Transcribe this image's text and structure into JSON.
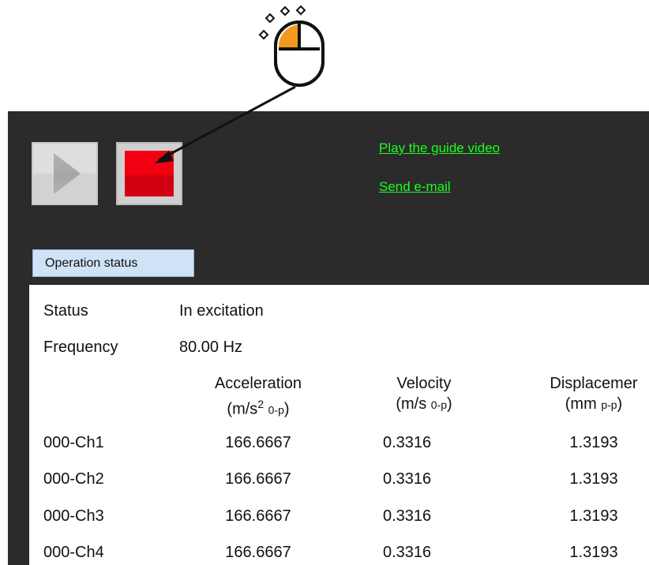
{
  "toolbar": {
    "play_icon": "play-icon",
    "stop_icon": "stop-icon",
    "stop_color": "#f00010"
  },
  "links": {
    "guide_video": "Play the guide video",
    "send_email": "Send e-mail",
    "color": "#19ff1e"
  },
  "tab": {
    "label": "Operation status"
  },
  "status": {
    "status_label": "Status",
    "status_value": "In excitation",
    "frequency_label": "Frequency",
    "frequency_value": "80.00 Hz"
  },
  "table": {
    "columns": [
      {
        "name": "Acceleration",
        "unit_open": "(m/s",
        "unit_sup": "2",
        "unit_sub": "0-p",
        "unit_close": ")"
      },
      {
        "name": "Velocity",
        "unit_open": "(m/s",
        "unit_sup": "",
        "unit_sub": "0-p",
        "unit_close": ")"
      },
      {
        "name": "Displacemer",
        "unit_open": "(mm",
        "unit_sup": "",
        "unit_sub": "p-p",
        "unit_close": ")"
      }
    ],
    "rows": [
      {
        "channel": "000-Ch1",
        "acceleration": "166.6667",
        "velocity": "0.3316",
        "displacement": "1.3193"
      },
      {
        "channel": "000-Ch2",
        "acceleration": "166.6667",
        "velocity": "0.3316",
        "displacement": "1.3193"
      },
      {
        "channel": "000-Ch3",
        "acceleration": "166.6667",
        "velocity": "0.3316",
        "displacement": "1.3193"
      },
      {
        "channel": "000-Ch4",
        "acceleration": "166.6667",
        "velocity": "0.3316",
        "displacement": "1.3193"
      }
    ]
  },
  "annotation": {
    "icon": "mouse-left-click-icon",
    "highlight_color": "#f39a1c"
  }
}
